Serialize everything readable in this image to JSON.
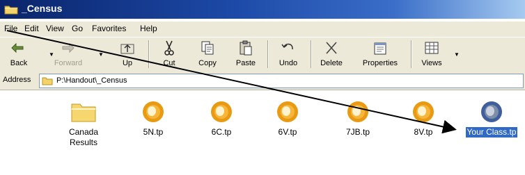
{
  "window": {
    "title": "_Census"
  },
  "menu": [
    "File",
    "Edit",
    "View",
    "Go",
    "Favorites",
    "Help"
  ],
  "toolbar": {
    "back": "Back",
    "forward": "Forward",
    "up": "Up",
    "cut": "Cut",
    "copy": "Copy",
    "paste": "Paste",
    "undo": "Undo",
    "delete": "Delete",
    "properties": "Properties",
    "views": "Views"
  },
  "address": {
    "label": "Address",
    "path": "P:\\Handout\\_Census"
  },
  "files": [
    {
      "name": "Canada",
      "name2": "Results",
      "icon": "folder-icon"
    },
    {
      "name": "5N.tp",
      "icon": "orange-sphere-icon"
    },
    {
      "name": "6C.tp",
      "icon": "orange-sphere-icon"
    },
    {
      "name": "6V.tp",
      "icon": "orange-sphere-icon"
    },
    {
      "name": "7JB.tp",
      "icon": "orange-sphere-icon"
    },
    {
      "name": "8V.tp",
      "icon": "orange-sphere-icon"
    },
    {
      "name": "Your Class.tp",
      "icon": "selected-sphere-icon",
      "selected": true
    }
  ],
  "colors": {
    "titlebar": "#0a246a",
    "chrome": "#ece9d8",
    "selection": "#316ac5"
  }
}
